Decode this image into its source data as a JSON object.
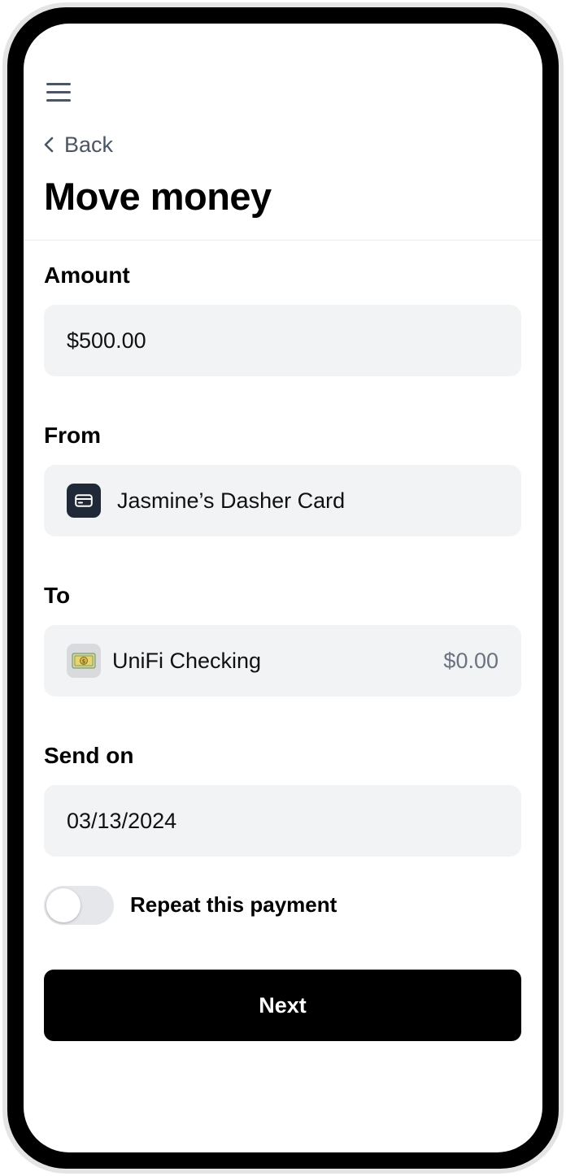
{
  "header": {
    "menu_icon": "hamburger-menu-icon",
    "back_label": "Back",
    "back_icon": "chevron-left-icon",
    "title": "Move money"
  },
  "amount": {
    "label": "Amount",
    "value": "$500.00"
  },
  "from": {
    "label": "From",
    "account_name": "Jasmine’s Dasher Card",
    "icon": "card-icon"
  },
  "to": {
    "label": "To",
    "account_name": "UniFi Checking",
    "balance": "$0.00",
    "icon": "money-icon"
  },
  "send_on": {
    "label": "Send on",
    "date": "03/13/2024"
  },
  "repeat": {
    "label": "Repeat this payment",
    "enabled": false
  },
  "next_button": {
    "label": "Next"
  },
  "colors": {
    "field_background": "#f2f3f5",
    "primary_button": "#000000",
    "muted_text": "#4b5563",
    "card_icon_background": "#1f2937"
  }
}
